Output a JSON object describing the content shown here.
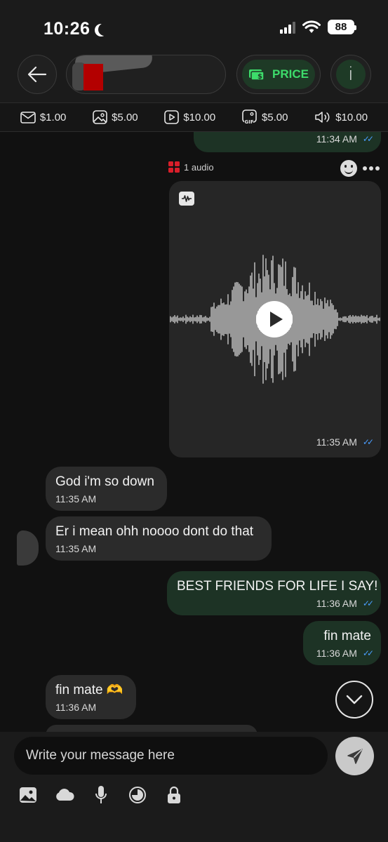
{
  "status_bar": {
    "time": "10:26",
    "battery": "88"
  },
  "header": {
    "price_label": "PRICE",
    "info_label": "i"
  },
  "price_strip": [
    {
      "icon": "envelope-icon",
      "label": "$1.00"
    },
    {
      "icon": "photo-icon",
      "label": "$5.00"
    },
    {
      "icon": "video-icon",
      "label": "$10.00"
    },
    {
      "icon": "gif-icon",
      "label": "$5.00"
    },
    {
      "icon": "speaker-icon",
      "label": "$10.00"
    }
  ],
  "chat": {
    "top_partial_time": "11:34 AM",
    "audio": {
      "label": "1 audio",
      "time": "11:35 AM"
    },
    "messages": [
      {
        "dir": "in",
        "text": "God i'm so down",
        "time": "11:35 AM"
      },
      {
        "dir": "in",
        "text": "Er i mean ohh noooo dont do that",
        "time": "11:35 AM"
      },
      {
        "dir": "out",
        "text": "BEST FRIENDS FOR LIFE I SAY!",
        "time": "11:36 AM"
      },
      {
        "dir": "out",
        "text": "fin mate",
        "time": "11:36 AM"
      },
      {
        "dir": "in",
        "text": "fin mate 🫶",
        "time": "11:36 AM"
      }
    ]
  },
  "composer": {
    "placeholder": "Write your message here"
  },
  "colors": {
    "accent_green": "#3ddc6b",
    "outgoing_bubble": "#1d3325",
    "incoming_bubble": "#2b2b2b",
    "read_tick": "#4a9eff"
  }
}
